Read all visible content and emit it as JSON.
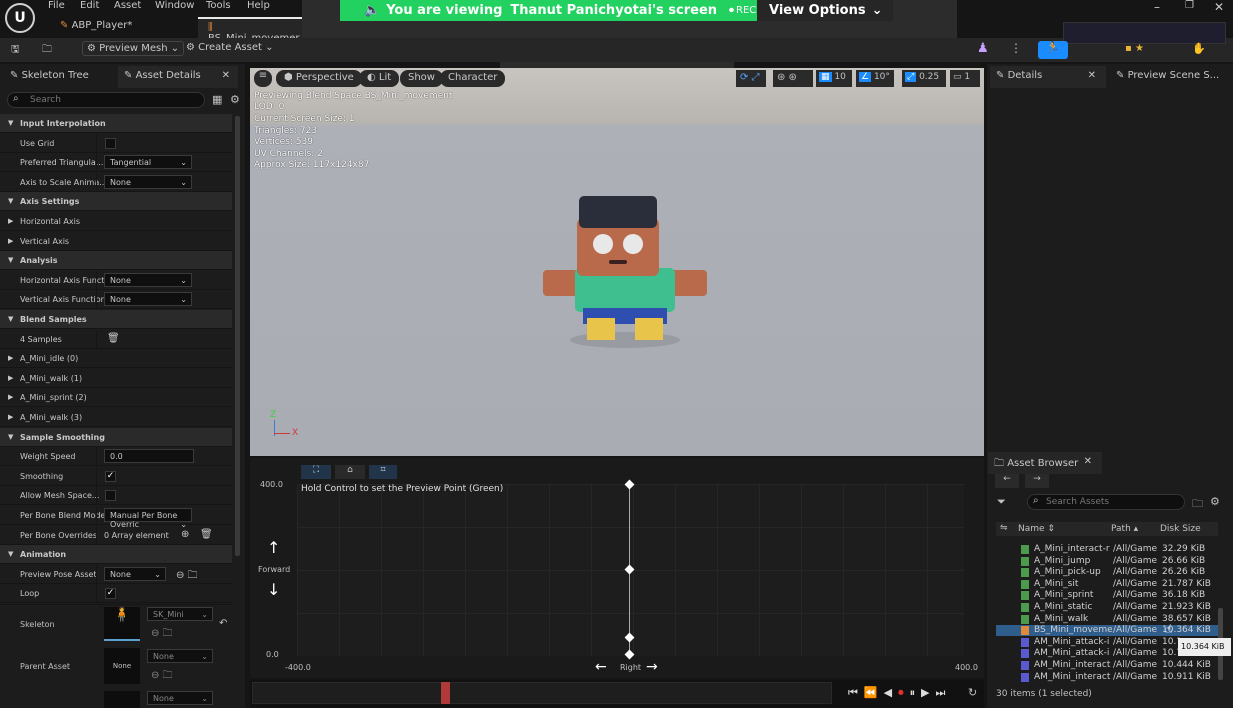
{
  "menu": [
    "File",
    "Edit",
    "Asset",
    "Window",
    "Tools",
    "Help"
  ],
  "tabs": [
    {
      "label": "ABP_Player*"
    },
    {
      "label": "BS_Mini_movemer"
    }
  ],
  "zoom": {
    "viewing": "You are viewing",
    "name": "Thanut Panichyotai's screen",
    "rec": "REC",
    "options": "View Options"
  },
  "toolbar": {
    "preview_mesh": "Preview Mesh",
    "create_asset": "Create Asset"
  },
  "left": {
    "tabs": [
      "Skeleton Tree",
      "Asset Details"
    ],
    "search_placeholder": "Search",
    "rows": [
      {
        "t": "cat",
        "l": "Input Interpolation"
      },
      {
        "t": "cb",
        "l": "Use Grid",
        "v": ""
      },
      {
        "t": "dd",
        "l": "Preferred Triangula...",
        "v": "Tangential"
      },
      {
        "t": "dd",
        "l": "Axis to Scale Anima...",
        "v": "None"
      },
      {
        "t": "cat",
        "l": "Axis Settings"
      },
      {
        "t": "sub",
        "l": "Horizontal Axis"
      },
      {
        "t": "sub",
        "l": "Vertical Axis"
      },
      {
        "t": "cat",
        "l": "Analysis"
      },
      {
        "t": "dd",
        "l": "Horizontal Axis Functi",
        "v": "None"
      },
      {
        "t": "dd",
        "l": "Vertical Axis Function",
        "v": "None"
      },
      {
        "t": "cat",
        "l": "Blend Samples"
      },
      {
        "t": "del",
        "l": "4 Samples"
      },
      {
        "t": "sub",
        "l": "A_Mini_idle (0)"
      },
      {
        "t": "sub",
        "l": "A_Mini_walk (1)"
      },
      {
        "t": "sub",
        "l": "A_Mini_sprint (2)"
      },
      {
        "t": "sub",
        "l": "A_Mini_walk (3)"
      },
      {
        "t": "cat",
        "l": "Sample Smoothing"
      },
      {
        "t": "num",
        "l": "Weight Speed",
        "v": "0.0"
      },
      {
        "t": "cb",
        "l": "Smoothing",
        "v": "✓"
      },
      {
        "t": "cb",
        "l": "Allow Mesh Space...",
        "v": ""
      },
      {
        "t": "dd",
        "l": "Per Bone Blend Mode",
        "v": "Manual Per Bone Overric"
      },
      {
        "t": "arr",
        "l": "Per Bone Overrides",
        "v": "0 Array element"
      },
      {
        "t": "cat",
        "l": "Animation"
      },
      {
        "t": "dd2",
        "l": "Preview Pose Asset",
        "v": "None"
      },
      {
        "t": "cb",
        "l": "Loop",
        "v": "✓"
      }
    ],
    "skeleton_label": "Skeleton",
    "skeleton_val": "SK_Mini",
    "parent_label": "Parent Asset",
    "parent_val": "None",
    "parent_thumb": "None",
    "extra_val": "None"
  },
  "viewport": {
    "buttons": [
      "Perspective",
      "Lit",
      "Show",
      "Character"
    ],
    "grid": "10",
    "angle": "10°",
    "scale": "0.25",
    "cam": "1",
    "info": [
      "Previewing Blend Space BS_Mini_movement",
      "LOD: 0",
      "Current Screen Size: 1",
      "Triangles: 723",
      "Vertices: 539",
      "UV Channels: 2",
      "Approx Size: 117x124x87"
    ]
  },
  "graph": {
    "hint": "Hold Control to set the Preview Point (Green)",
    "ymax": "400.0",
    "ymin": "0.0",
    "xmin": "-400.0",
    "xmax": "400.0",
    "xlabel": "Right",
    "ylabel": "Forward"
  },
  "details": {
    "tabs": [
      "Details",
      "Preview Scene S..."
    ]
  },
  "assets": {
    "title": "Asset Browser",
    "search_placeholder": "Search Assets",
    "headers": [
      "Name",
      "Path",
      "Disk Size"
    ],
    "rows": [
      {
        "n": "A_Mini_interact-r",
        "p": "/All/Game",
        "s": "32.29 KiB"
      },
      {
        "n": "A_Mini_jump",
        "p": "/All/Game",
        "s": "26.66 KiB"
      },
      {
        "n": "A_Mini_pick-up",
        "p": "/All/Game",
        "s": "26.26 KiB"
      },
      {
        "n": "A_Mini_sit",
        "p": "/All/Game",
        "s": "21.787 KiB"
      },
      {
        "n": "A_Mini_sprint",
        "p": "/All/Game",
        "s": "36.18 KiB"
      },
      {
        "n": "A_Mini_static",
        "p": "/All/Game",
        "s": "21.923 KiB"
      },
      {
        "n": "A_Mini_walk",
        "p": "/All/Game",
        "s": "38.657 KiB"
      },
      {
        "n": "BS_Mini_moveme",
        "p": "/All/Game",
        "s": "10.364 KiB"
      },
      {
        "n": "AM_Mini_attack-i",
        "p": "/All/Game",
        "s": "10.?"
      },
      {
        "n": "AM_Mini_attack-i",
        "p": "/All/Game",
        "s": "10.?"
      },
      {
        "n": "AM_Mini_interact",
        "p": "/All/Game",
        "s": "10.444 KiB"
      },
      {
        "n": "AM_Mini_interact",
        "p": "/All/Game",
        "s": "10.911 KiB"
      }
    ],
    "tooltip": "10.364 KiB",
    "status": "30 items (1 selected)"
  }
}
